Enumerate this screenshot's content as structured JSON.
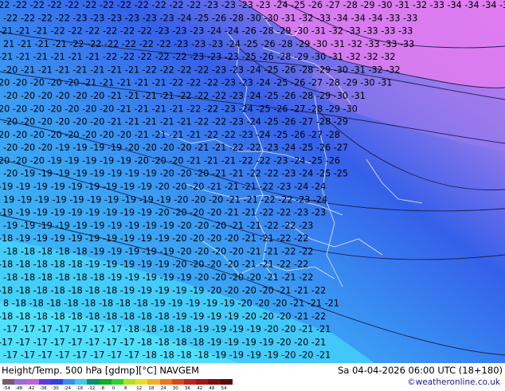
{
  "map": {
    "background_colors": [
      "#40ccf8",
      "#3a9cf4",
      "#3560ea",
      "#9a7aec",
      "#e07cf0"
    ],
    "contour_color": "#1c2050",
    "border_color": "#e8ecf4",
    "rows": [
      {
        "t": "22 -22 -22 -22 -22 -22 -22 -22 -22 -22 -22 -22 -23 -23 -23 -23 -24 -25 -26 -27 -28 -29 -30 -31 -32 -33 -34 -34 -34 -33 -33 -33"
      },
      {
        "t": "-22 -22 -22 -22 -23 -23 -23 -23 -23 -23 -24 -25 -26 -28 -30 -30 -31 -32 -33 -34 -34 -34 -33 -33"
      },
      {
        "t": "-21 -21 -21 -22 -22 -22 -22 -22 -22 -23 -23 -23 -24 -24 -26 -28 -29 -30 -31 -32 -33 -33 -33 -33"
      },
      {
        "t": "21 -21 -21 -21 -22 -22 -22 -22 -22 -22 -23 -23 -23 -24 -25 -26 -28 -29 -30 -31 -32 -33 -33 -33"
      },
      {
        "t": "-21 -21 -21 -21 -21 -21 -22 -22 -22 -22 -22 -23 -23 -23 -25 -26 -28 -29 -30 -31 -32 -32 -32"
      },
      {
        "t": "-20 -21 -21 -21 -21 -21 -21 -21 -22 -22 -22 -22 -23 -23 -24 -25 -26 -28 -29 -30 -31 -32 -32"
      },
      {
        "t": "20 -20 -20 -20 -20 -21 -21 -21 -21 -21 -22 -22 -22 -23 -23 -24 -25 -26 -27 -28 -29 -30 -31"
      },
      {
        "t": "-20 -20 -20 -20 -20 -20 -21 -21 -21 -21 -22 -22 -22 -23 -24 -25 -26 -28 -29 -30 -31"
      },
      {
        "t": "20 -20 -20 -20 -20 -20 -20 -21 -21 -21 -21 -22 -22 -23 -24 -25 -26 -27 -28 -29 -30"
      },
      {
        "t": "-20 -20 -20 -20 -20 -20 -21 -21 -21 -21 -21 -22 -22 -23 -24 -25 -26 -27 -28 -29"
      },
      {
        "t": "20 -20 -20 -20 -20 -20 -20 -20 -21 -21 -21 -21 -22 -22 -23 -24 -25 -26 -27 -28"
      },
      {
        "t": "-20 -20 -20 -19 -19 -19 -19 -20 -20 -20 -20 -21 -21 -22 -22 -23 -24 -25 -26 -27"
      },
      {
        "t": "20 -20 -20 -19 -19 -19 -19 -19 -20 -20 -20 -21 -21 -21 -22 -22 -23 -24 -25 -26"
      },
      {
        "t": "-20 -19 -19 -19 -19 -19 -19 -19 -19 -20 -20 -20 -21 -21 -22 -22 -23 -24 -25 -25"
      },
      {
        "t": "-19 -19 -19 -19 -19 -19 -19 -19 -19 -20 -20 -20 -21 -21 -21 -22 -23 -24 -24"
      },
      {
        "t": "19 -19 -19 -19 -19 -19 -19 -19 -19 -19 -20 -20 -20 -21 -21 -22 -22 -23 -24"
      },
      {
        "t": "-19 -19 -19 -19 -19 -19 -19 -19 -19 -20 -20 -20 -20 -21 -21 -22 -22 -23 -23"
      },
      {
        "t": "-19 -19 -19 -19 -19 -19 -19 -19 -19 -19 -20 -20 -20 -21 -21 -22 -22 -23"
      },
      {
        "t": "-18 -19 -19 -19 -19 -19 -19 -19 -19 -19 -20 -20 -20 -20 -21 -21 -22 -22"
      },
      {
        "t": "-18 -18 -18 -18 -18 -19 -19 -19 -19 -19 -20 -20 -20 -20 -21 -21 -22 -22"
      },
      {
        "t": "-18 -18 -18 -18 -18 -19 -19 -19 -19 -19 -20 -20 -20 -20 -21 -21 -22 -22"
      },
      {
        "t": "-18 -18 -18 -18 -18 -18 -19 -19 -19 -19 -19 -20 -20 -20 -20 -21 -21 -22"
      },
      {
        "t": "-18 -18 -18 -18 -18 -18 -18 -19 -19 -19 -19 -19 -20 -20 -20 -20 -21 -21 -22"
      },
      {
        "t": "8 -18 -18 -18 -18 -18 -18 -18 -18 -19 -19 -19 -19 -19 -20 -20 -20 -21 -21 -21"
      },
      {
        "t": "-18 -18 -18 -18 -18 -18 -18 -18 -18 -18 -19 -19 -19 -19 -20 -20 -20 -21 -22"
      },
      {
        "t": "-17 -17 -17 -17 -17 -17 -17 -18 -18 -18 -18 -19 -19 -19 -19 -20 -20 -21 -21"
      },
      {
        "t": "-17 -17 -17 -17 -17 -17 -17 -17 -18 -18 -18 -18 -19 -19 -19 -19 -20 -20 -21"
      },
      {
        "t": "-17 -17 -17 -17 -17 -17 -17 -17 -18 -18 -18 -18 -19 -19 -19 -19 -20 -20 -21"
      }
    ]
  },
  "footer": {
    "title": "Height/Temp. 500 hPa [gdmp][°C] NAVGEM",
    "datetime": "Sa 04-04-2026 06:00 UTC (18+180)",
    "credit": "©weatheronline.co.uk"
  },
  "colorbar": {
    "ticks": [
      "-54",
      "-48",
      "-42",
      "-38",
      "-30",
      "-24",
      "-18",
      "-12",
      "-8",
      "0",
      "8",
      "12",
      "18",
      "24",
      "30",
      "36",
      "42",
      "48",
      "54"
    ],
    "colors": [
      "#7a5a6a",
      "#9c6cd8",
      "#c060e0",
      "#5a3cd8",
      "#2a44e0",
      "#3a8ef0",
      "#3cc8f0",
      "#0a9070",
      "#10b020",
      "#30d030",
      "#b0e020",
      "#e8e020",
      "#f0b020",
      "#e87818",
      "#d84818",
      "#c02020",
      "#a01810",
      "#801010",
      "#600808"
    ]
  }
}
